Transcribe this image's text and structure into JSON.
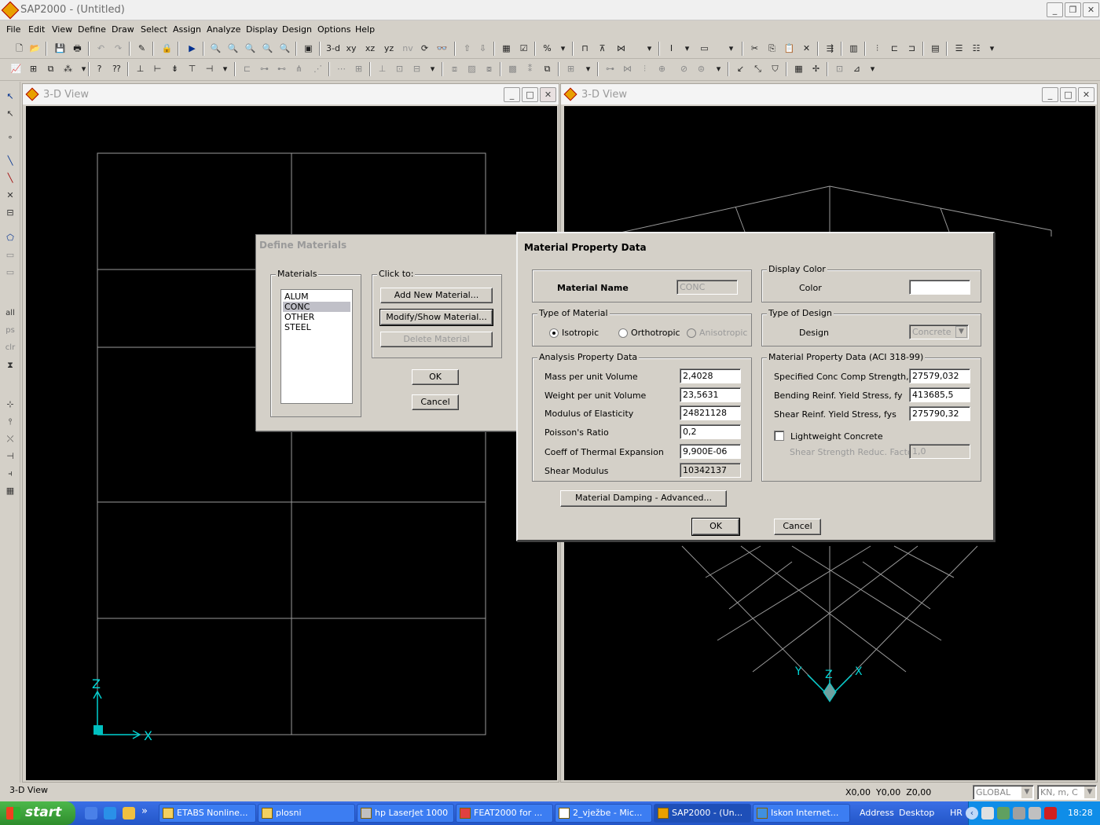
{
  "app": {
    "title": "SAP2000 - (Untitled)"
  },
  "menu": [
    "File",
    "Edit",
    "View",
    "Define",
    "Draw",
    "Select",
    "Assign",
    "Analyze",
    "Display",
    "Design",
    "Options",
    "Help"
  ],
  "toolbar": {
    "labels": {
      "three_d": "3-d",
      "xy": "xy",
      "xz": "xz",
      "yz": "yz",
      "nv": "nv"
    }
  },
  "left_toolbar": {
    "all": "all",
    "ps": "ps",
    "clr": "clr"
  },
  "views": [
    {
      "title": "3-D View",
      "axis_x": "X",
      "axis_z": "Z"
    },
    {
      "title": "3-D View",
      "axis_x": "X",
      "axis_y": "Y",
      "axis_z": "Z"
    }
  ],
  "define_materials": {
    "title": "Define Materials",
    "materials_label": "Materials",
    "materials": [
      "ALUM",
      "CONC",
      "OTHER",
      "STEEL"
    ],
    "selected": "CONC",
    "click_to_label": "Click to:",
    "add_new": "Add New Material...",
    "modify_show": "Modify/Show Material...",
    "delete": "Delete Material",
    "ok": "OK",
    "cancel": "Cancel"
  },
  "material_property": {
    "title": "Material Property Data",
    "material_name_label": "Material Name",
    "material_name": "CONC",
    "display_color_label": "Display Color",
    "color_label": "Color",
    "color_value": "#ffffff",
    "type_of_material_label": "Type of Material",
    "isotropic": "Isotropic",
    "orthotropic": "Orthotropic",
    "anisotropic": "Anisotropic",
    "type_of_design_label": "Type of Design",
    "design_label": "Design",
    "design_value": "Concrete",
    "analysis_label": "Analysis Property Data",
    "analysis": [
      {
        "label": "Mass per unit Volume",
        "value": "2,4028"
      },
      {
        "label": "Weight per unit Volume",
        "value": "23,5631"
      },
      {
        "label": "Modulus of Elasticity",
        "value": "24821128"
      },
      {
        "label": "Poisson's Ratio",
        "value": "0,2"
      },
      {
        "label": "Coeff of Thermal Expansion",
        "value": "9,900E-06"
      },
      {
        "label": "Shear Modulus",
        "value": "10342137"
      }
    ],
    "design_data_label": "Material Property Data (ACI 318-99)",
    "design_data": [
      {
        "label": "Specified Conc Comp Strength, f'c",
        "value": "27579,032"
      },
      {
        "label": "Bending Reinf. Yield Stress, fy",
        "value": "413685,5"
      },
      {
        "label": "Shear Reinf. Yield Stress, fys",
        "value": "275790,32"
      }
    ],
    "lightweight_label": "Lightweight Concrete",
    "shear_reduc_label": "Shear Strength Reduc. Factor",
    "shear_reduc_value": "1,0",
    "damping_button": "Material Damping - Advanced...",
    "ok": "OK",
    "cancel": "Cancel"
  },
  "status": {
    "left": "3-D View",
    "coords": "X0,00  Y0,00  Z0,00",
    "coord_system": "GLOBAL",
    "units": "KN, m, C"
  },
  "taskbar": {
    "start": "start",
    "chevron": "»",
    "tasks": [
      "ETABS Nonline...",
      "plosni",
      "hp LaserJet 1000",
      "FEAT2000 for ...",
      "2_vježbe - Mic...",
      "SAP2000 - (Un...",
      "Iskon Internet..."
    ],
    "address": "Address",
    "desktop": "Desktop",
    "lang": "HR",
    "clock": "18:28"
  }
}
